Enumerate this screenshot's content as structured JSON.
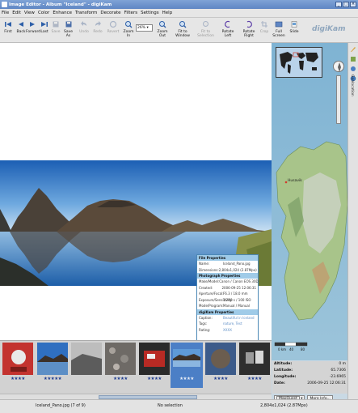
{
  "window": {
    "title": "Image Editor - Album \"Iceland\" - digiKam"
  },
  "menu": [
    "File",
    "Edit",
    "View",
    "Color",
    "Enhance",
    "Transform",
    "Decorate",
    "Filters",
    "Settings",
    "Help"
  ],
  "toolbar": {
    "first": "First",
    "back": "Back",
    "forward": "Forward",
    "last": "Last",
    "save": "Save",
    "save_as": "Save As",
    "undo": "Undo",
    "redo": "Redo",
    "revert": "Revert",
    "zoom_in": "Zoom In",
    "zoom_value": "26%",
    "zoom_out": "Zoom Out",
    "fit_window": "Fit to Window",
    "fit_selection": "Fit to Selection",
    "rotate_left": "Rotate Left",
    "rotate_right": "Rotate Right",
    "crop": "Crop",
    "full_screen": "Full Screen",
    "slide": "Slide"
  },
  "brand": "digiKam",
  "sidebar": {
    "tab_label": "Geolocation"
  },
  "map": {
    "label": "Husavik",
    "scale": [
      "0 km",
      "40",
      "80"
    ]
  },
  "gps": {
    "altitude_label": "Altitude:",
    "altitude": "0 m",
    "latitude_label": "Latitude:",
    "latitude": "65.7306",
    "longitude_label": "Longitude:",
    "longitude": "-23.6965",
    "date_label": "Date:",
    "date": "2006-09-25 12:06:31",
    "service": "MapQuest",
    "more_info": "More Info..."
  },
  "properties": {
    "file_header": "File Properties",
    "name_k": "Name:",
    "name_v": "Iceland_Pano.jpg",
    "dim_k": "Dimensions:",
    "dim_v": "2,804x1,024 (2.87Mpx)",
    "photo_header": "Photograph Properties",
    "make_k": "Make/Model:",
    "make_v": "Canon / Canon EOS 30D",
    "created_k": "Created:",
    "created_v": "2006-09-25 12:06:31",
    "lens_k": "Aperture/Focal:",
    "lens_v": "F6.3 / 18.0 mm",
    "exposure_k": "Exposure/Sensitivity:",
    "exposure_v": "1/200 s / 100 ISO",
    "mode_k": "Mode/Program:",
    "mode_v": "Manual / Manual",
    "dk_header": "digiKam Properties",
    "caption_k": "Caption:",
    "caption_v": "Beautiful in Iceland",
    "tags_k": "Tags:",
    "tags_v": "nature, Test",
    "rating_k": "Rating:",
    "rating_v": "XXXX"
  },
  "thumbnails": [
    {
      "stars": "★★★★"
    },
    {
      "stars": "★★★★★"
    },
    {
      "stars": ""
    },
    {
      "stars": "★★★★"
    },
    {
      "stars": "★★★★"
    },
    {
      "stars": "★★★★"
    },
    {
      "stars": "★★★★"
    },
    {
      "stars": "★★★★"
    }
  ],
  "status": {
    "file": "Iceland_Pano.jpg (7 of 9)",
    "selection": "No selection",
    "size": "2,804x1,024 (2.87Mpx)"
  }
}
